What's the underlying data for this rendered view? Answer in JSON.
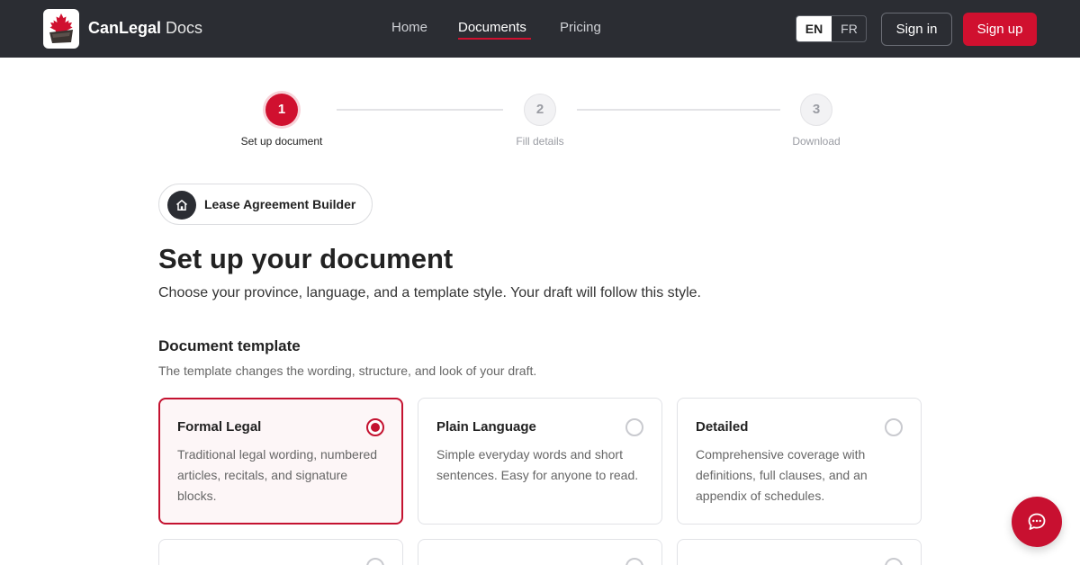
{
  "header": {
    "brand_bold": "CanLegal",
    "brand_light": " Docs",
    "nav": [
      {
        "label": "Home",
        "active": false
      },
      {
        "label": "Documents",
        "active": true
      },
      {
        "label": "Pricing",
        "active": false
      }
    ],
    "lang_options": [
      "EN",
      "FR"
    ],
    "lang_selected": "EN",
    "sign_in": "Sign in",
    "sign_up": "Sign up"
  },
  "stepper": {
    "steps": [
      {
        "number": "1",
        "label": "Set up document",
        "state": "active"
      },
      {
        "number": "2",
        "label": "Fill details",
        "state": "upcoming"
      },
      {
        "number": "3",
        "label": "Download",
        "state": "upcoming"
      }
    ]
  },
  "builder": {
    "label": "Lease Agreement Builder",
    "icon": "home-icon"
  },
  "main": {
    "title": "Set up your document",
    "subtitle": "Choose your province, language, and a template style. Your draft will follow this style."
  },
  "template_section": {
    "title": "Document template",
    "subtitle": "The template changes the wording, structure, and look of your draft.",
    "options": [
      {
        "title": "Formal Legal",
        "description": "Traditional legal wording, numbered articles, recitals, and signature blocks.",
        "selected": true
      },
      {
        "title": "Plain Language",
        "description": "Simple everyday words and short sentences. Easy for anyone to read.",
        "selected": false
      },
      {
        "title": "Detailed",
        "description": "Comprehensive coverage with definitions, full clauses, and an appendix of schedules.",
        "selected": false
      },
      {
        "title": "",
        "description": "",
        "selected": false
      },
      {
        "title": "",
        "description": "",
        "selected": false
      },
      {
        "title": "",
        "description": "",
        "selected": false
      }
    ]
  },
  "chat": {
    "icon": "chat-bubble-icon"
  },
  "colors": {
    "header_bg": "#2b2d33",
    "accent": "#d0102f",
    "selected_border": "#c41230",
    "selected_bg": "#fdf6f7"
  }
}
